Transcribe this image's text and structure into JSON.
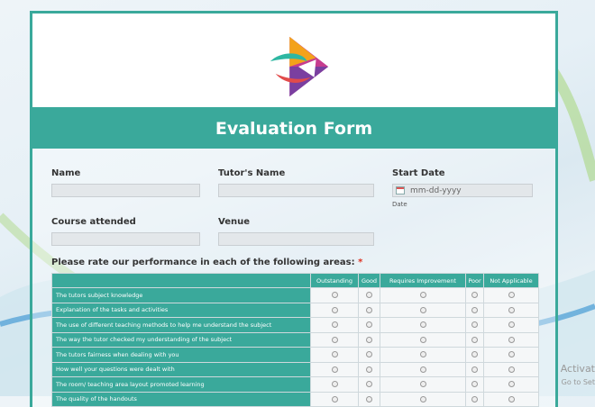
{
  "form": {
    "title": "Evaluation Form",
    "name_label": "Name",
    "tutor_label": "Tutor's Name",
    "start_date_label": "Start Date",
    "date_placeholder": "mm-dd-yyyy",
    "date_sublabel": "Date",
    "course_label": "Course attended",
    "venue_label": "Venue",
    "rating_prompt": "Please rate our performance in each of the following areas:",
    "required_mark": "*"
  },
  "rating": {
    "columns": [
      "Outstanding",
      "Good",
      "Requires Improvement",
      "Poor",
      "Not Applicable"
    ],
    "questions": [
      "The tutors subject knowledge",
      "Explanation of the tasks and activities",
      "The use of different teaching methods to help me understand the subject",
      "The way the tutor checked my understanding of the subject",
      "The tutors fairness when dealing with you",
      "How well your questions were dealt with",
      "The room/ teaching area layout promoted learning",
      "The quality of the handouts"
    ]
  },
  "watermark": {
    "line1": "Activat",
    "line2": "Go to Set"
  },
  "colors": {
    "accent": "#3aa99b"
  }
}
